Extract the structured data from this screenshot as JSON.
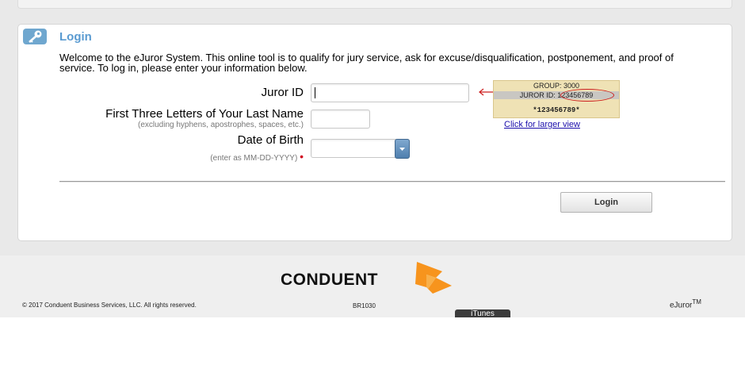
{
  "login": {
    "title": "Login",
    "welcome": "Welcome to the eJuror System. This online tool is to qualify for jury service, ask for excuse/disqualification, postponement, and proof of service. To log in, please enter your information below.",
    "juror_id_label": "Juror ID",
    "juror_id_value": "",
    "last_name_label": "First Three Letters of Your Last Name",
    "last_name_hint": "(excluding hyphens, apostrophes, spaces, etc.)",
    "last_name_value": "",
    "dob_label": "Date of Birth",
    "dob_hint": "(enter as MM-DD-YYYY)",
    "dob_value": "",
    "required_marker": "•",
    "button_label": "Login"
  },
  "sample_card": {
    "group_line": "GROUP:  3000",
    "juror_id_line": "JUROR ID: 123456789",
    "barcode_line": "*123456789*",
    "larger_view_link": "Click for larger view"
  },
  "footer": {
    "brand": "CONDUENT",
    "copyright": "© 2017 Conduent Business Services, LLC. All rights reserved.",
    "code": "BR1030",
    "product": "eJuror",
    "trademark": "TM",
    "itunes_label": "iTunes"
  },
  "colors": {
    "accent_blue": "#5a9bd1",
    "brand_orange": "#f7941d",
    "required_red": "#d0021b",
    "link_blue": "#1a0dab"
  }
}
